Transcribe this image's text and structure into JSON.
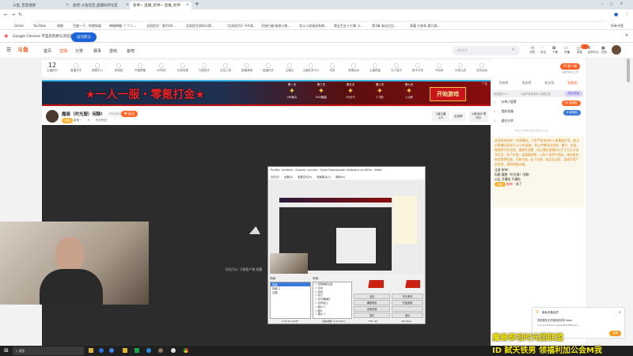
{
  "browser": {
    "tabs": [
      {
        "label": "斗鱼_百度搜索"
      },
      {
        "label": "鱼吧-斗鱼社区,直播间评论区"
      },
      {
        "label": "新神~ 直播_新神~ 直播_新神"
      }
    ],
    "url": "douyu.com/2123967_r=0.04204018205808568&&dyshid=a1f555-51f7d488d8bc617b999437fe00071701",
    "bookmarks": [
      "Gmail",
      "YouTube",
      "地图",
      "百度一下，你就知道",
      "神楣神楣（'-'ﾂ'ン...",
      "太阳信号：叙尔00...",
      "太阳信号资料与第...",
      "《太阳信号》平A流...",
      "开始行者(血统小航...",
      "北斗小说阅读系统...",
      "第五百五十七章 小...",
      "第1章 来自之后...",
      "原著 七修系,第九两..."
    ],
    "all_bookmarks": "所有书签",
    "infobar": {
      "text": "Google Chrome 不是您的默认浏览器",
      "button": "设为默认"
    }
  },
  "site": {
    "logo": "斗鱼",
    "nav": [
      "首页",
      "直播",
      "分类",
      "赛事",
      "游戏",
      "鱼吧"
    ],
    "search_placeholder": "wtykit",
    "header_icons": [
      "历史",
      "关注",
      "下载",
      "开播",
      "消息",
      "创作中心",
      "任务"
    ],
    "msg_badge": "9"
  },
  "toolbar": {
    "level": "12",
    "level_label": "主播积分",
    "items": [
      "直播开关",
      "数据中心",
      "音频回",
      "开播提醒",
      "AR特效",
      "礼物设置",
      "万能助手",
      "互动工具",
      "直播海报",
      "直播任务",
      "主播日",
      "主播任务中心",
      "特效",
      "竞猜活动",
      "主播视窗",
      "无人值守",
      "新手引导",
      "节目单",
      "礼物心愿",
      "发布活动",
      "斗鱼商城",
      "主播口袋",
      "视频剪辑",
      "斗鱼大厅",
      "加入公会",
      "开播推广分析",
      "更多"
    ],
    "pc_btn": "PC客户端",
    "pc_sub": "主播开播可上传"
  },
  "banner": {
    "title": "★一人一服・零氪打金★",
    "days": [
      {
        "d": "第一天",
        "p": "2W鱼丸"
      },
      {
        "d": "第三天",
        "p": "500福袋"
      },
      {
        "d": "第五天",
        "p": "30分卡"
      },
      {
        "d": "第六天",
        "p": "1飞机"
      },
      {
        "d": "第七天",
        "p": "1火箭"
      }
    ],
    "cta": "开始游戏",
    "ad": "广告"
  },
  "streamer": {
    "name": "魔兽（时光服）闲聊!",
    "room": "7903603",
    "follow": "关注",
    "badge": "1级",
    "category": "新神~",
    "viewers": "0",
    "tag": "时光怀旧",
    "actions": [
      "1级主播 1/3",
      "全站榜",
      "斗鱼活动 限时中"
    ]
  },
  "video": {
    "tip": "你还可以 下载客户端 观看"
  },
  "right": {
    "tabs": [
      "贡献榜",
      "贵族榜",
      "粉丝团",
      "超能团"
    ],
    "notice_bar": "系统提示 5 ♪",
    "notice_bar2": "斗鱼严禁未成年人充值打赏",
    "become": "成为贵族",
    "ranks": [
      {
        "n": "1",
        "name": "炒鸡小菠萝",
        "badge": "40 新闻社"
      },
      {
        "n": "2",
        "name": "我的祝福",
        "badge": "8 新闻社"
      },
      {
        "n": "3",
        "name": "虚空大师"
      }
    ],
    "more": "未来周分榜单上榜仅展示前10名",
    "notice": "欢迎来到新神~ 的直播间。斗鱼严禁未成年人直播或打赏。依法对直播内容进行24小时巡查，禁止传播违法违规、暴力、低俗、赌博等不良信息。请理性消费，如主播在直播时以不正当方式诱导打赏、私下交易，请谨慎判断，以防人身财产损失。请勿轻信各类招聘征婚、代练代抽、私下交易、购买礼包码、游戏币等广告信息，谨防网络诈骗。",
    "lines": [
      {
        "k": "法游",
        "v": "新神~"
      },
      {
        "k": "标题",
        "v": "魔兽（时光服）闲聊!"
      },
      {
        "k": "公告",
        "v": "开播啦 不播啦"
      }
    ],
    "chat": {
      "badge": "1级",
      "user": "新神~",
      "msg": "来了"
    }
  },
  "obs": {
    "title": "Profile: Untitled - Scenes: scenes - Open Broadcaster Software v0.659b - 64bit",
    "menu": [
      "文件(F)",
      "设置(S)",
      "配置文件(P)",
      "场景集合(C)",
      "帮助(H)"
    ],
    "scenes_label": "场景:",
    "scenes": [
      "场景",
      "场景 2",
      "注释"
    ],
    "sources_label": "来源:",
    "sources": [
      "视频捕捉设备",
      "互动",
      "游戏",
      "窗口",
      "显示器捕获",
      "全局窗口",
      "图片 2",
      "图片",
      "图片 3"
    ],
    "buttons": [
      "设定",
      "停止串流",
      "编辑场景",
      "开始录制",
      "全局来源",
      "",
      "插件",
      "退出"
    ],
    "status": [
      "0:00:02 (LIVE)",
      "丢失帧数: 0 (0.00%)",
      "FPS: 60",
      "294 kb/s"
    ]
  },
  "toast": {
    "title": "隐私设备保护",
    "text": "发现程序正在使用麦克风 dows",
    "path": "C:\\Users\\Admin\\AppData\\OBS\\obs...",
    "button": "设置"
  },
  "overlay": {
    "line1": "魔兽泰坦时光团联盟",
    "line2": "ID 弑天铁男 领福利加公会M我"
  },
  "taskbar": {
    "search": "搜索"
  }
}
